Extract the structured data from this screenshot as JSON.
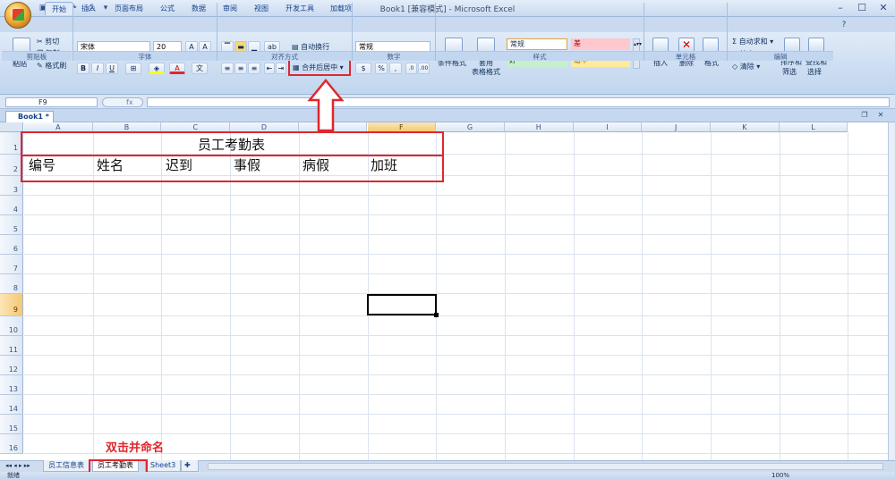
{
  "window": {
    "title": "Book1  [兼容模式] - Microsoft Excel"
  },
  "ribbon_tabs": [
    "开始",
    "插入",
    "页面布局",
    "公式",
    "数据",
    "审阅",
    "视图",
    "开发工具",
    "加载项"
  ],
  "clipboard": {
    "paste": "粘贴",
    "cut": "剪切",
    "copy": "复制",
    "format_painter": "格式刷",
    "label": "剪贴板"
  },
  "font": {
    "name": "宋体",
    "size": "20",
    "bold": "B",
    "italic": "I",
    "underline": "U",
    "label": "字体"
  },
  "alignment": {
    "wrap": "自动换行",
    "merge_center": "合并后居中",
    "label": "对齐方式"
  },
  "number": {
    "format": "常规",
    "percent": "%",
    "comma": ",",
    "label": "数字"
  },
  "styles": {
    "conditional": "条件格式",
    "table_format_line1": "套用",
    "table_format_line2": "表格格式",
    "normal": "常规",
    "bad": "差",
    "good": "好",
    "neutral": "适中",
    "label": "样式"
  },
  "cells_group": {
    "insert": "插入",
    "delete": "删除",
    "format": "格式",
    "label": "单元格"
  },
  "editing": {
    "autosum": "自动求和",
    "fill": "填充",
    "clear": "清除",
    "sort_line1": "排序和",
    "sort_line2": "筛选",
    "find_line1": "查找和",
    "find_line2": "选择",
    "label": "编辑"
  },
  "formula_bar": {
    "name_box": "F9",
    "fx": "fx"
  },
  "document_tab": "Book1 *",
  "columns": [
    "A",
    "B",
    "C",
    "D",
    "E",
    "F",
    "G",
    "H",
    "I",
    "J",
    "K",
    "L"
  ],
  "rows": [
    "1",
    "2",
    "3",
    "4",
    "5",
    "6",
    "7",
    "8",
    "9",
    "10",
    "11",
    "12",
    "13",
    "14",
    "15",
    "16"
  ],
  "cells": {
    "title": "员工考勤表",
    "headers": [
      "编号",
      "姓名",
      "迟到",
      "事假",
      "病假",
      "加班"
    ]
  },
  "selected_cell": "F9",
  "sheet_tabs": [
    "员工信息表",
    "员工考勤表",
    "Sheet3"
  ],
  "active_sheet": "员工考勤表",
  "status": {
    "ready": "就绪",
    "zoom": "100%"
  },
  "annotation": "双击并命名",
  "colors": {
    "highlight": "#e0262e",
    "bad_fill": "#ffc7ce",
    "good_fill": "#c6efce",
    "neutral_fill": "#ffeb9c"
  }
}
